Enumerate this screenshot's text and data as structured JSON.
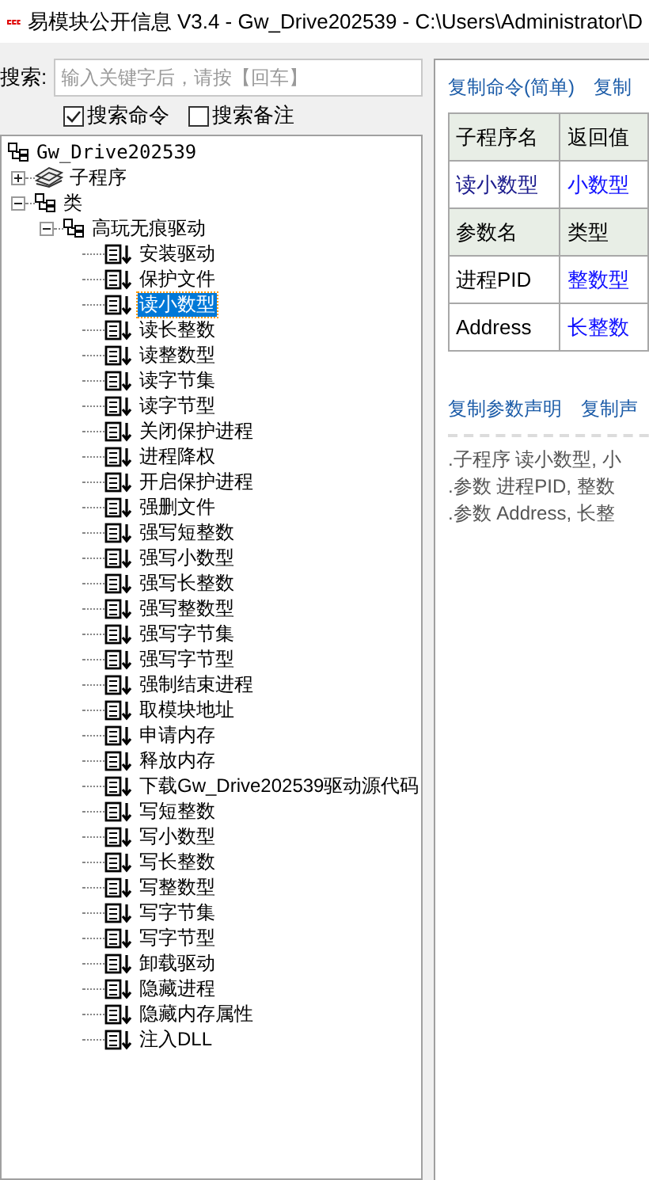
{
  "window": {
    "title": "易模块公开信息 V3.4 - Gw_Drive202539 - C:\\Users\\Administrator\\D"
  },
  "search": {
    "label": "搜索:",
    "placeholder": "输入关键字后，请按【回车】"
  },
  "options": [
    {
      "label": "搜索命令",
      "checked": true
    },
    {
      "label": "搜索备注",
      "checked": false
    }
  ],
  "tree": [
    {
      "label": "Gw_Drive202539",
      "kind": "module",
      "selected": false,
      "children": [
        {
          "label": "子程序",
          "kind": "stack",
          "selected": false,
          "expanded": false
        },
        {
          "label": "类",
          "kind": "module",
          "selected": false,
          "expanded": true,
          "children": [
            {
              "label": "高玩无痕驱动",
              "kind": "module",
              "selected": false,
              "expanded": true,
              "children": [
                {
                  "label": "安装驱动",
                  "kind": "command",
                  "selected": false
                },
                {
                  "label": "保护文件",
                  "kind": "command",
                  "selected": false
                },
                {
                  "label": "读小数型",
                  "kind": "command",
                  "selected": true
                },
                {
                  "label": "读长整数",
                  "kind": "command",
                  "selected": false
                },
                {
                  "label": "读整数型",
                  "kind": "command",
                  "selected": false
                },
                {
                  "label": "读字节集",
                  "kind": "command",
                  "selected": false
                },
                {
                  "label": "读字节型",
                  "kind": "command",
                  "selected": false
                },
                {
                  "label": "关闭保护进程",
                  "kind": "command",
                  "selected": false
                },
                {
                  "label": "进程降权",
                  "kind": "command",
                  "selected": false
                },
                {
                  "label": "开启保护进程",
                  "kind": "command",
                  "selected": false
                },
                {
                  "label": "强删文件",
                  "kind": "command",
                  "selected": false
                },
                {
                  "label": "强写短整数",
                  "kind": "command",
                  "selected": false
                },
                {
                  "label": "强写小数型",
                  "kind": "command",
                  "selected": false
                },
                {
                  "label": "强写长整数",
                  "kind": "command",
                  "selected": false
                },
                {
                  "label": "强写整数型",
                  "kind": "command",
                  "selected": false
                },
                {
                  "label": "强写字节集",
                  "kind": "command",
                  "selected": false
                },
                {
                  "label": "强写字节型",
                  "kind": "command",
                  "selected": false
                },
                {
                  "label": "强制结束进程",
                  "kind": "command",
                  "selected": false
                },
                {
                  "label": "取模块地址",
                  "kind": "command",
                  "selected": false
                },
                {
                  "label": "申请内存",
                  "kind": "command",
                  "selected": false
                },
                {
                  "label": "释放内存",
                  "kind": "command",
                  "selected": false
                },
                {
                  "label": "下载Gw_Drive202539驱动源代码",
                  "kind": "command",
                  "selected": false
                },
                {
                  "label": "写短整数",
                  "kind": "command",
                  "selected": false
                },
                {
                  "label": "写小数型",
                  "kind": "command",
                  "selected": false
                },
                {
                  "label": "写长整数",
                  "kind": "command",
                  "selected": false
                },
                {
                  "label": "写整数型",
                  "kind": "command",
                  "selected": false
                },
                {
                  "label": "写字节集",
                  "kind": "command",
                  "selected": false
                },
                {
                  "label": "写字节型",
                  "kind": "command",
                  "selected": false
                },
                {
                  "label": "卸载驱动",
                  "kind": "command",
                  "selected": false
                },
                {
                  "label": "隐藏进程",
                  "kind": "command",
                  "selected": false
                },
                {
                  "label": "隐藏内存属性",
                  "kind": "command",
                  "selected": false
                },
                {
                  "label": "注入DLL",
                  "kind": "command",
                  "selected": false
                }
              ]
            }
          ]
        }
      ]
    }
  ],
  "top_links": [
    "复制命令(简单)",
    "复制"
  ],
  "table": {
    "rows": [
      {
        "kind": "header",
        "cells": [
          {
            "text": "子程序名",
            "kind": "plain"
          },
          {
            "text": "返回值",
            "kind": "plain"
          }
        ]
      },
      {
        "kind": "data",
        "cells": [
          {
            "text": "读小数型",
            "kind": "name"
          },
          {
            "text": "小数型",
            "kind": "type"
          }
        ]
      },
      {
        "kind": "header",
        "cells": [
          {
            "text": "参数名",
            "kind": "plain"
          },
          {
            "text": "类型",
            "kind": "plain"
          }
        ]
      },
      {
        "kind": "data",
        "cells": [
          {
            "text": "进程PID",
            "kind": "plain"
          },
          {
            "text": "整数型",
            "kind": "type"
          }
        ]
      },
      {
        "kind": "data",
        "cells": [
          {
            "text": "Address",
            "kind": "plain"
          },
          {
            "text": "长整数",
            "kind": "type"
          }
        ]
      }
    ]
  },
  "bottom_links": [
    "复制参数声明",
    "复制声"
  ],
  "code_lines": [
    ".子程序 读小数型, 小",
    ".参数 进程PID, 整数",
    ".参数 Address, 长整"
  ]
}
